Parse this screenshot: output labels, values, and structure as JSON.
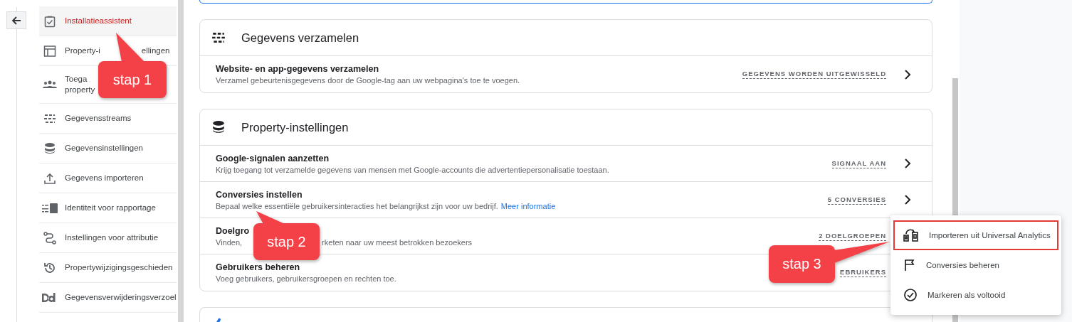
{
  "sidebar": {
    "items": [
      {
        "lines": [
          [
            "Installatieassistent"
          ]
        ],
        "selected": true
      },
      {
        "lines": [
          [
            "Property-i",
            "ellingen"
          ]
        ],
        "selected": false
      },
      {
        "lines": [
          [
            "Toega"
          ],
          [
            "property"
          ]
        ],
        "selected": false
      },
      {
        "lines": [
          [
            "Gegevensstreams"
          ]
        ],
        "selected": false
      },
      {
        "lines": [
          [
            "Gegevensinstellingen"
          ]
        ],
        "selected": false
      },
      {
        "lines": [
          [
            "Gegevens importeren"
          ]
        ],
        "selected": false
      },
      {
        "lines": [
          [
            "Identiteit voor rapportage"
          ]
        ],
        "selected": false
      },
      {
        "lines": [
          [
            "Instellingen voor attributie"
          ]
        ],
        "selected": false
      },
      {
        "lines": [
          [
            "Propertywijzigingsgeschieden"
          ]
        ],
        "selected": false
      },
      {
        "lines": [
          [
            "Gegevensverwijderingsverzoel"
          ]
        ],
        "selected": false
      }
    ]
  },
  "cards": [
    {
      "title": "Gegevens verzamelen",
      "rows": [
        {
          "title": "Website- en app-gegevens verzamelen",
          "description": [
            "Verzamel gebeurtenisgegevens door de Google-tag aan uw webpagina's toe te voegen."
          ],
          "status": "GEGEVENS WORDEN UITGEWISSELD",
          "chevron": true
        }
      ]
    },
    {
      "title": "Property-instellingen",
      "rows": [
        {
          "title": "Google-signalen aanzetten",
          "description": [
            "Krijg toegang tot verzamelde gegevens van mensen met Google-accounts die advertentiepersonalisatie toestaan."
          ],
          "status": "SIGNAAL AAN",
          "chevron": true
        },
        {
          "title": "Conversies instellen",
          "description": [
            "Bepaal welke essentiële gebruikersinteracties het belangrijkst zijn voor uw bedrijf."
          ],
          "link": "Meer informatie",
          "status": "5 CONVERSIES",
          "chevron": true
        },
        {
          "title": "Doelgro",
          "description": [
            "Vinden, ",
            "rketen naar uw meest betrokken bezoekers"
          ],
          "status": "2 DOELGROEPEN",
          "chevron": false
        },
        {
          "title": "Gebruikers beheren",
          "description": [
            "Voeg gebruikers, gebruikersgroepen en rechten toe."
          ],
          "status": "EBRUIKERS",
          "chevron": false
        }
      ]
    }
  ],
  "menu": {
    "items": [
      {
        "label": "Importeren uit Universal Analytics",
        "highlighted": true
      },
      {
        "label": "Conversies beheren",
        "highlighted": false
      },
      {
        "label": "Markeren als voltooid",
        "highlighted": false
      }
    ]
  },
  "callouts": [
    "stap 1",
    "stap 2",
    "stap 3"
  ]
}
